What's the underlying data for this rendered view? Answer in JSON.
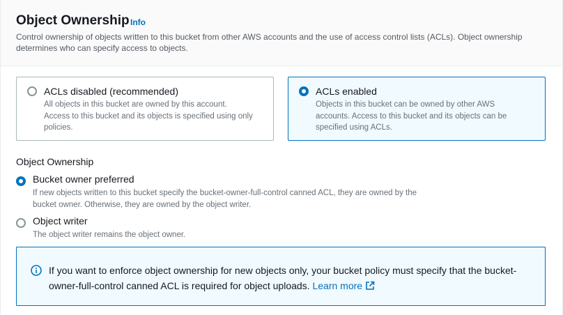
{
  "header": {
    "title": "Object Ownership",
    "info_link": "Info",
    "description": "Control ownership of objects written to this bucket from other AWS accounts and the use of access control lists (ACLs). Object ownership determines who can specify access to objects."
  },
  "acl_tiles": [
    {
      "label": "ACLs disabled (recommended)",
      "description": "All objects in this bucket are owned by this account. Access to this bucket and its objects is specified using only policies.",
      "selected": false
    },
    {
      "label": "ACLs enabled",
      "description": "Objects in this bucket can be owned by other AWS accounts. Access to this bucket and its objects can be specified using ACLs.",
      "selected": true
    }
  ],
  "ownership": {
    "label": "Object Ownership",
    "options": [
      {
        "label": "Bucket owner preferred",
        "description": "If new objects written to this bucket specify the bucket-owner-full-control canned ACL, they are owned by the bucket owner. Otherwise, they are owned by the object writer.",
        "selected": true
      },
      {
        "label": "Object writer",
        "description": "The object writer remains the object owner.",
        "selected": false
      }
    ]
  },
  "alert": {
    "text": "If you want to enforce object ownership for new objects only, your bucket policy must specify that the bucket-owner-full-control canned ACL is required for object uploads.",
    "link_text": "Learn more",
    "icon": "info-circle-icon"
  },
  "colors": {
    "accent": "#0073bb",
    "selected_bg": "#f1faff",
    "secondary_text": "#687078"
  }
}
